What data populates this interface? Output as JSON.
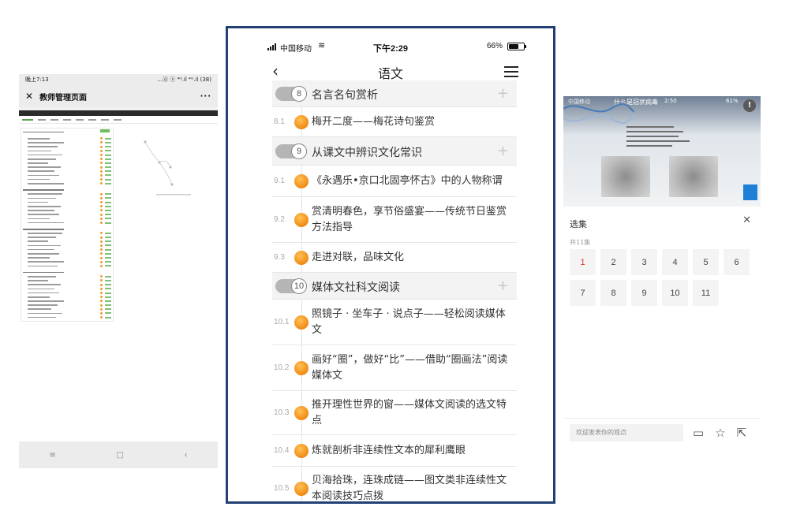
{
  "left_phone": {
    "status_time": "晚上7:13",
    "status_icons": "...ⓓ ⓢ ⁴ᴳ.il ⁴ᴳ.il (38)",
    "title": "教师管理页面",
    "close_label": "✕",
    "more_label": "···",
    "nav_menu_icon": "≡",
    "nav_home_icon": "□",
    "nav_back_icon": "‹"
  },
  "center_phone": {
    "carrier": "中国移动",
    "time": "下午2:29",
    "battery_percent": "66%",
    "battery_level": 0.66,
    "title": "语文",
    "back_label": "‹",
    "items": [
      {
        "kind": "chapter",
        "number": "8",
        "title": "名言名句赏析"
      },
      {
        "kind": "section",
        "number": "8.1",
        "dot": "",
        "title": "梅开二度——梅花诗句鉴赏"
      },
      {
        "kind": "chapter",
        "number": "9",
        "title": "从课文中辨识文化常识"
      },
      {
        "kind": "section",
        "number": "9.1",
        "dot": "",
        "title": "《永遇乐•京口北固亭怀古》中的人物称谓"
      },
      {
        "kind": "section",
        "number": "9.2",
        "dot": "",
        "title": "赏清明春色，享节俗盛宴——传统节日鉴赏方法指导"
      },
      {
        "kind": "section",
        "number": "9.3",
        "dot": "",
        "title": "走进对联，品味文化"
      },
      {
        "kind": "chapter",
        "number": "10",
        "title": "媒体文社科文阅读"
      },
      {
        "kind": "section",
        "number": "10.1",
        "dot": "",
        "title": "照镜子 · 坐车子 · 说点子——轻松阅读媒体文"
      },
      {
        "kind": "section",
        "number": "10.2",
        "dot": "",
        "title": "画好“圈”，做好“比”——借助“圈画法”阅读媒体文"
      },
      {
        "kind": "section",
        "number": "10.3",
        "dot": "",
        "title": "推开理性世界的窗——媒体文阅读的选文特点"
      },
      {
        "kind": "section",
        "number": "10.4",
        "dot": "",
        "title": "炼就剖析非连续性文本的犀利鹰眼"
      },
      {
        "kind": "section",
        "number": "10.5",
        "dot": "",
        "title": "贝海拾珠，连珠成链——图文类非连续性文本阅读技巧点拨"
      }
    ]
  },
  "right_phone": {
    "video_status_carrier": "中国移动",
    "video_title": "什么是冠状病毒",
    "video_time": "2:50",
    "video_battery": "61%",
    "info_label": "!",
    "section_label": "选集",
    "close_label": "✕",
    "episode_count": "共11集",
    "episodes": [
      "1",
      "2",
      "3",
      "4",
      "5",
      "6",
      "7",
      "8",
      "9",
      "10",
      "11"
    ],
    "active_episode": "1",
    "comment_placeholder": "欢迎发表你的观点",
    "comment_icon": "▭",
    "favorite_icon": "☆",
    "share_icon": "⇱"
  }
}
